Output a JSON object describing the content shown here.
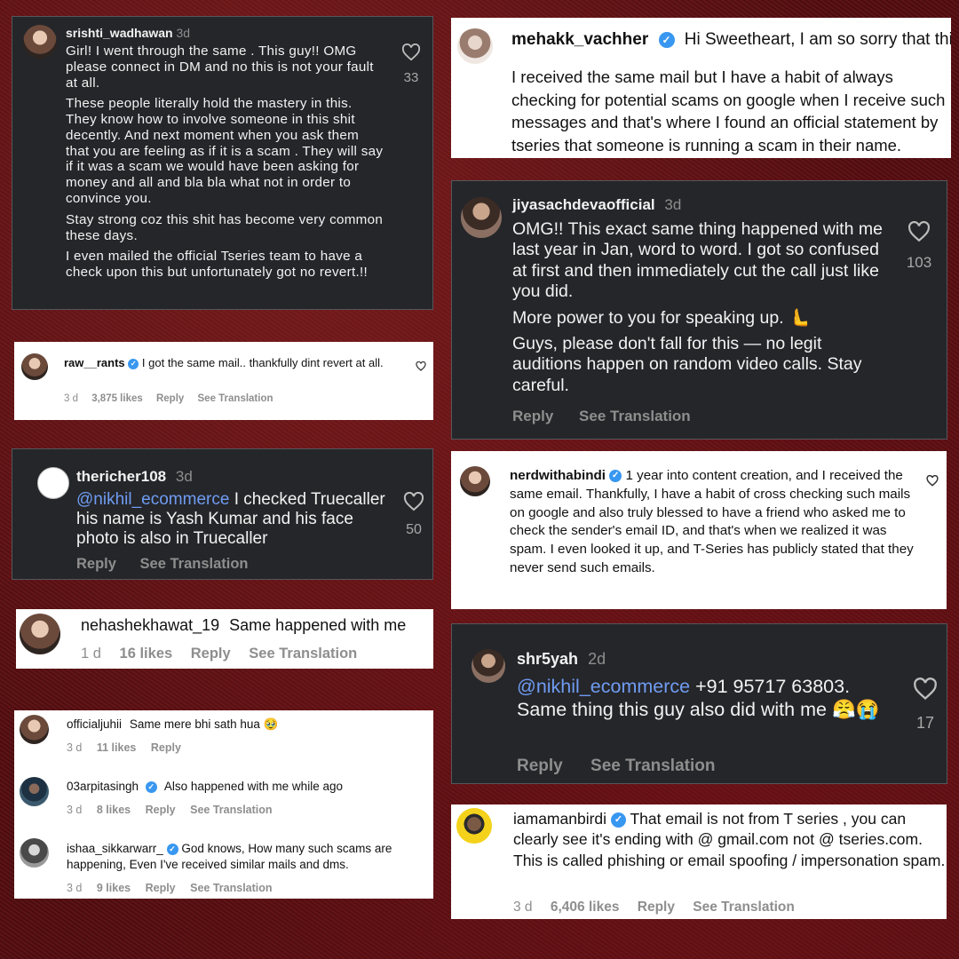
{
  "comments": {
    "srishti": {
      "username": "srishti_wadhawan",
      "time": "3d",
      "paragraphs": [
        "Girl! I went through the same . This guy!! OMG please connect in DM and no this is not your fault at all.",
        "These people literally hold the mastery in this. They know how to involve someone in this shit decently. And next moment when you ask them that you are feeling as if it is a scam . They will say if it was a scam we would have been asking for money and all and bla bla what not in order to convince you.",
        "Stay strong coz this shit has become very common these days.",
        "I even mailed the official Tseries team to have a check upon this but unfortunately got no revert.!!"
      ],
      "likes": "33"
    },
    "mehakk": {
      "username": "mehakk_vachher",
      "line1": "Hi Sweetheart, I am so sorry that this",
      "body": "I received the same mail but I have a habit of always checking for potential scams on google when I receive such messages and that's where I found an official statement by tseries that someone is running a scam in their name."
    },
    "raw": {
      "username": "raw__rants",
      "text": "I got the same mail.. thankfully dint revert at all.",
      "time": "3 d",
      "likes": "3,875 likes",
      "reply": "Reply",
      "translation": "See Translation"
    },
    "jiya": {
      "username": "jiyasachdevaofficial",
      "time": "3d",
      "paragraphs": [
        "OMG!! This exact same thing happened with me last year in Jan, word to word. I got so confused at first and then immediately cut the call just like you did.",
        "More power to you for speaking up. 🫷",
        "Guys, please don't fall for this — no legit auditions happen on random video calls. Stay careful."
      ],
      "likes": "103",
      "reply": "Reply",
      "translation": "See Translation"
    },
    "thericher": {
      "username": "thericher108",
      "time": "3d",
      "mention": "@nikhil_ecommerce",
      "text": "I checked Truecaller his name is Yash Kumar and his face photo is also in Truecaller",
      "likes": "50",
      "reply": "Reply",
      "translation": "See Translation"
    },
    "nerd": {
      "username": "nerdwithabindi",
      "text": "1 year into content creation, and I received the same email. Thankfully, I have a habit of cross checking such mails on google and also truly blessed to have a friend who asked me to check the sender's email ID, and that's when we realized it was spam. I even looked it up, and T-Series has publicly stated that they never send such emails."
    },
    "neha": {
      "username": "nehashekhawat_19",
      "text": "Same happened with me",
      "time": "1 d",
      "likes": "16 likes",
      "reply": "Reply",
      "translation": "See Translation"
    },
    "shr": {
      "username": "shr5yah",
      "time": "2d",
      "mention": "@nikhil_ecommerce",
      "text": "+91 95717 63803. Same thing this guy also did with me",
      "emoji": "😤😭",
      "likes": "17",
      "reply": "Reply",
      "translation": "See Translation"
    },
    "juhii": {
      "username": "officialjuhii",
      "text": "Same mere bhi sath hua 🥹",
      "time": "3 d",
      "likes": "11 likes",
      "reply": "Reply"
    },
    "arpita": {
      "username": "03arpitasingh",
      "text": "Also happened with me while ago",
      "time": "3 d",
      "likes": "8 likes",
      "reply": "Reply",
      "translation": "See Translation"
    },
    "ishaa": {
      "username": "ishaa_sikkarwarr_",
      "text": "God knows, How many such scams are happening, Even I've received similar mails and dms.",
      "time": "3 d",
      "likes": "9 likes",
      "reply": "Reply",
      "translation": "See Translation"
    },
    "iamaman": {
      "username": "iamamanbirdi",
      "text": "That email is not from T series , you can clearly see it's ending with @ gmail.com not @ tseries.com. This is called phishing or email spoofing / impersonation spam.",
      "time": "3 d",
      "likes": "6,406 likes",
      "reply": "Reply",
      "translation": "See Translation"
    }
  },
  "icons": {
    "verified": "✓",
    "heart": "heart-icon"
  },
  "colors": {
    "mention": "#6f9cf2",
    "verified": "#3897f0",
    "dark_card": "#25262a",
    "background": "#5a0f12"
  }
}
